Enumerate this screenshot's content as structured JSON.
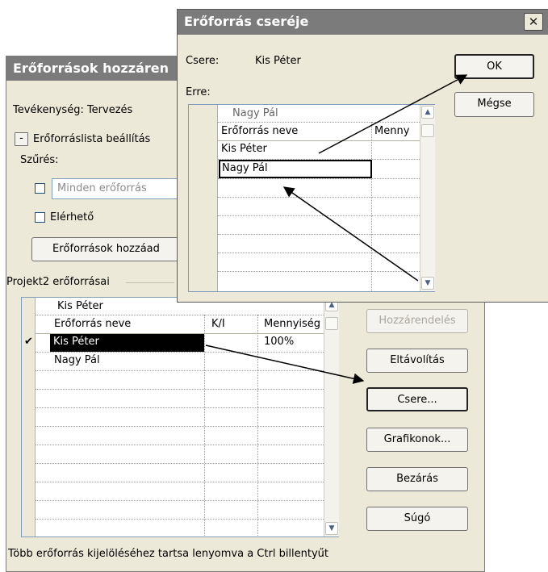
{
  "back_dialog": {
    "title": "Erőforrások hozzáren",
    "task_label": "Tevékenység: Tervezés",
    "collapse_symbol": "-",
    "options_label": "Erőforráslista beállítás",
    "filter_label": "Szűrés:",
    "filter_value": "Minden erőforrás",
    "available_label": "Elérhető",
    "add_resources_label": "Erőforrások hozzáad",
    "group_label": "Projekt2 erőforrásai",
    "edit_value": "Kis Péter",
    "columns": [
      "Erőforrás neve",
      "K/I",
      "Mennyiség"
    ],
    "rows": [
      {
        "check": "✔",
        "name": "Kis Péter",
        "ki": "",
        "amount": "100%"
      },
      {
        "check": "",
        "name": "Nagy Pál",
        "ki": "",
        "amount": ""
      }
    ],
    "buttons": {
      "assign": "Hozzárendelés",
      "remove": "Eltávolítás",
      "replace": "Csere...",
      "graphs": "Grafikonok...",
      "close": "Bezárás",
      "help": "Súgó"
    },
    "footer": "Több erőforrás kijelöléséhez tartsa lenyomva a Ctrl billentyűt"
  },
  "front_dialog": {
    "title": "Erőforrás cseréje",
    "close_glyph": "✕",
    "replace_label": "Csere:",
    "replace_value": "Kis Péter",
    "with_label": "Erre:",
    "edit_value": "Nagy Pál",
    "columns": [
      "Erőforrás neve",
      "Menny"
    ],
    "rows": [
      {
        "name": "Kis Péter"
      },
      {
        "name": "Nagy Pál"
      }
    ],
    "ok": "OK",
    "cancel": "Mégse"
  }
}
